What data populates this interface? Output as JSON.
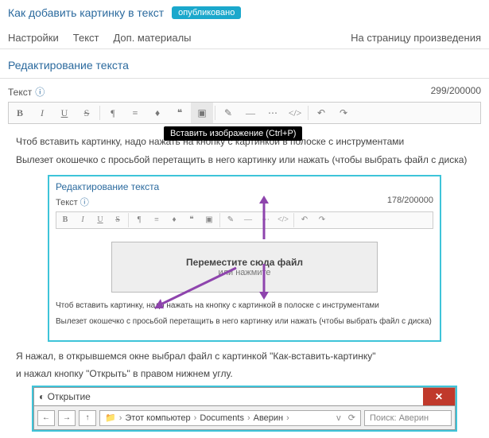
{
  "header": {
    "title": "Как добавить картинку в текст",
    "status": "опубликовано"
  },
  "tabs": {
    "items": [
      "Настройки",
      "Текст",
      "Доп. материалы"
    ],
    "right_link": "На страницу произведения"
  },
  "section": {
    "title": "Редактирование текста"
  },
  "field": {
    "label": "Текст",
    "counter": "299/200000"
  },
  "tooltip": "Вставить изображение (Ctrl+P)",
  "body": {
    "p1": "Чтоб вставить картинку, надо нажать на кнопку с картинкой в полоске с инструментами",
    "p2": "Вылезет окошечко с просьбой перетащить в него картинку или нажать (чтобы выбрать файл с диска)",
    "p3": "Я нажал, в открывшемся окне выбрал файл с картинкой \"Как-вставить-картинку\"",
    "p4": "и нажал кнопку \"Открыть\" в правом нижнем углу."
  },
  "inner": {
    "title": "Редактирование текста",
    "field_label": "Текст",
    "counter": "178/200000",
    "drop_line1": "Переместите сюда файл",
    "drop_line2": "или нажмите",
    "p1": "Чтоб вставить картинку, надо нажать на кнопку с картинкой в полоске с инструментами",
    "p2": "Вылезет окошечко с просьбой перетащить в него картинку или нажать (чтобы выбрать файл с диска)"
  },
  "dialog": {
    "title": "Открытие",
    "path": [
      "Этот компьютер",
      "Documents",
      "Аверин"
    ],
    "search_placeholder": "Поиск: Аверин"
  }
}
